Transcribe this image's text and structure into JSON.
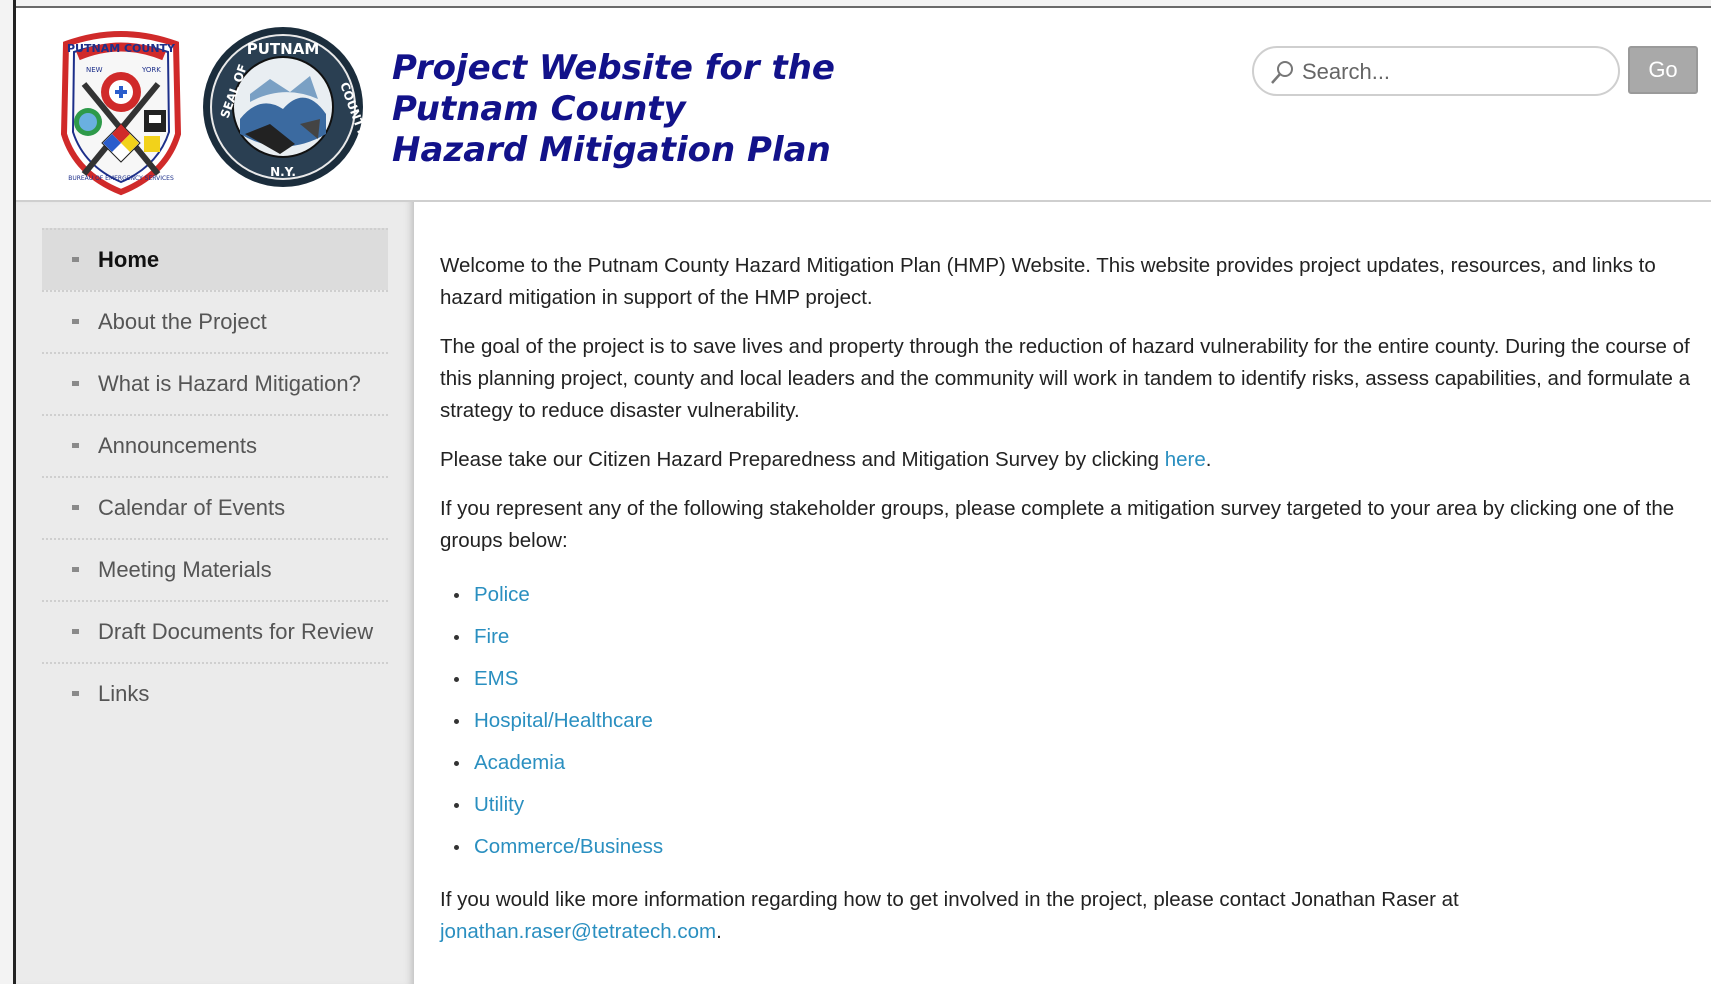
{
  "header": {
    "title_lines": [
      "Project Website for the",
      "Putnam County",
      "Hazard Mitigation Plan"
    ],
    "logos": [
      "putnam-county-bureau-of-emergency-services-patch",
      "seal-of-putnam-county-ny"
    ],
    "logo1_text": "PUTNAM COUNTY NEW YORK BUREAU OF EMERGENCY SERVICES",
    "logo2_text": "SEAL OF PUTNAM COUNTY N.Y."
  },
  "search": {
    "placeholder": "Search...",
    "button_label": "Go",
    "icon": "search-icon"
  },
  "sidebar": {
    "items": [
      {
        "label": "Home",
        "active": true
      },
      {
        "label": "About the Project",
        "active": false
      },
      {
        "label": "What is Hazard Mitigation?",
        "active": false
      },
      {
        "label": "Announcements",
        "active": false
      },
      {
        "label": "Calendar of Events",
        "active": false
      },
      {
        "label": "Meeting Materials",
        "active": false
      },
      {
        "label": "Draft Documents for Review",
        "active": false
      },
      {
        "label": "Links",
        "active": false
      }
    ]
  },
  "main": {
    "intro": "Welcome to the Putnam County Hazard Mitigation Plan (HMP) Website.  This website provides project updates, resources, and links to hazard mitigation in support of the HMP project.",
    "goal": "The goal of the project is to save lives and property through the reduction of hazard vulnerability for the entire county.  During the course of this planning project, county and local leaders and the community will work in tandem to identify risks, assess capabilities, and formulate a strategy to reduce disaster vulnerability.",
    "survey_text": "Please take our Citizen Hazard Preparedness and Mitigation Survey by clicking ",
    "survey_link": "here",
    "survey_end": ".",
    "stakeholder_text": "If you represent any of the following stakeholder groups, please complete a mitigation survey targeted to your area by clicking one of the groups below:",
    "groups": [
      "Police",
      "Fire",
      "EMS",
      "Hospital/Healthcare",
      "Academia",
      "Utility",
      "Commerce/Business"
    ],
    "contact_text": "If you would like more information regarding how to get involved in the project, please contact Jonathan Raser at ",
    "contact_email": "jonathan.raser@tetratech.com",
    "contact_end": "."
  },
  "colors": {
    "title": "#12128a",
    "link": "#2a8fc0",
    "sidebar_bg": "#ebebeb",
    "active_bg": "#dcdcdc"
  }
}
